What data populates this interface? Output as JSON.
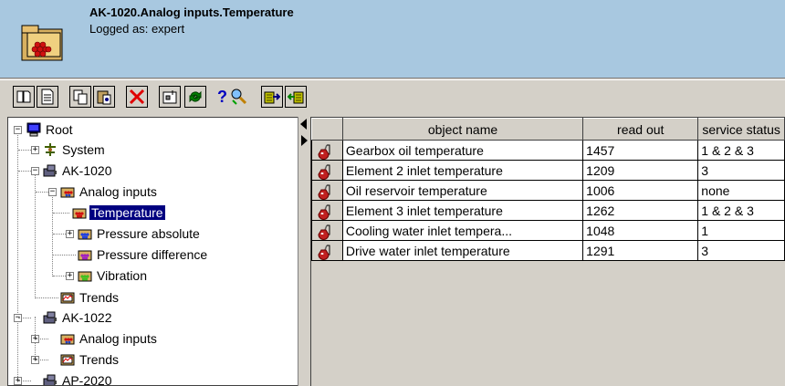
{
  "header": {
    "title": "AK-1020.Analog inputs.Temperature",
    "subtitle": "Logged as: expert",
    "icon": "folder-icon"
  },
  "toolbar": [
    {
      "name": "new-icon"
    },
    {
      "name": "document-icon"
    },
    {
      "name": "copy-icon"
    },
    {
      "name": "paste-icon"
    },
    {
      "name": "delete-icon"
    },
    {
      "name": "properties-icon"
    },
    {
      "name": "refresh-icon"
    },
    {
      "name": "help-icon"
    },
    {
      "name": "search-icon"
    },
    {
      "name": "import-icon"
    },
    {
      "name": "export-icon"
    }
  ],
  "tree": {
    "items": [
      {
        "label": "Root",
        "icon": "computer-icon"
      },
      {
        "label": "System",
        "icon": "network-icon"
      },
      {
        "label": "AK-1020",
        "icon": "device-icon"
      },
      {
        "label": "Analog inputs",
        "icon": "folder-icon"
      },
      {
        "label": "Temperature",
        "icon": "folder-icon"
      },
      {
        "label": "Pressure absolute",
        "icon": "folder-icon"
      },
      {
        "label": "Pressure difference",
        "icon": "folder-icon"
      },
      {
        "label": "Vibration",
        "icon": "folder-icon"
      },
      {
        "label": "Trends",
        "icon": "trends-icon"
      },
      {
        "label": "AK-1022",
        "icon": "device-icon"
      },
      {
        "label": "Analog inputs",
        "icon": "folder-icon"
      },
      {
        "label": "Trends",
        "icon": "trends-icon"
      },
      {
        "label": "AP-2020",
        "icon": "device-icon"
      }
    ],
    "selected": "Temperature"
  },
  "table": {
    "columns": [
      "object name",
      "read out",
      "service status"
    ],
    "rows": [
      {
        "name": "Gearbox oil temperature",
        "readout": "1457",
        "status": "1 & 2 & 3"
      },
      {
        "name": "Element 2 inlet temperature",
        "readout": "1209",
        "status": "3"
      },
      {
        "name": "Oil reservoir temperature",
        "readout": "1006",
        "status": "none"
      },
      {
        "name": "Element 3 inlet temperature",
        "readout": "1262",
        "status": "1 & 2 & 3"
      },
      {
        "name": "Cooling water inlet tempera...",
        "readout": "1048",
        "status": "1"
      },
      {
        "name": "Drive water inlet temperature",
        "readout": "1291",
        "status": "3"
      }
    ]
  },
  "colors": {
    "header_bg": "#a8c8e0",
    "selection": "#000080",
    "window_bg": "#d4d0c8"
  }
}
